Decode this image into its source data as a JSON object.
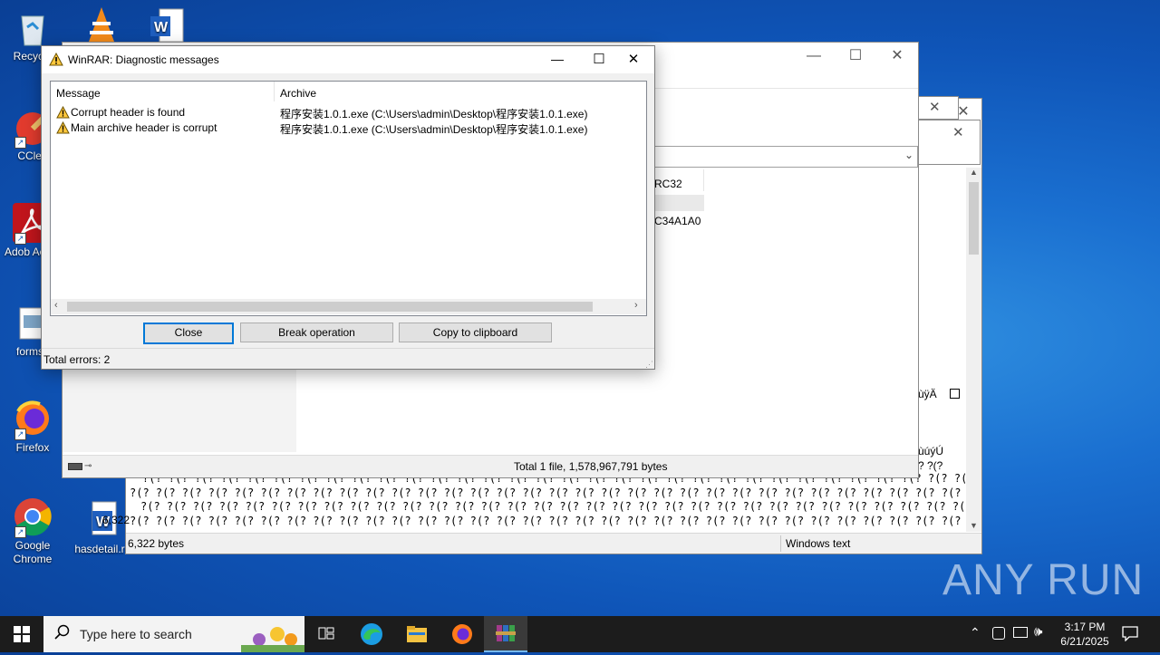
{
  "desktop": {
    "icons": [
      {
        "label": "Recycle"
      },
      {
        "label": "CClea"
      },
      {
        "label": "Adob Acrob"
      },
      {
        "label": "formsc"
      },
      {
        "label": "Firefox"
      },
      {
        "label": "Google Chrome"
      },
      {
        "label": "hasdetail.r"
      }
    ]
  },
  "notepad": {
    "garbage_line": "?(?  ?(?  ?(?  ?(?  ?(?  ?(?  ?(?  ?(?  ?(?  ?(?  ?(?  ?(?  ?(?  ?(?  ?(?  ?(?  ?(?  ?(?  ?(?  ?(?  ?(?  ?(?  ?(?  ?(?  ?(?  ?(?  ?(?  ?(?  ?(?  ?(?  ?(?  ?(?  ?(?",
    "side_text_1": "ùÿÄ",
    "side_text_2": "ùúýÚ",
    "side_text_3": "?  ?(?",
    "behind_text": "6,322",
    "status_size": "6,322 bytes",
    "status_encoding": "Windows text"
  },
  "winrar_main": {
    "col_crc": "RC32",
    "crc_value": "C34A1A0",
    "status_total": "Total 1 file, 1,578,967,791 bytes"
  },
  "dialog": {
    "title": "WinRAR: Diagnostic messages",
    "col_message": "Message",
    "col_archive": "Archive",
    "rows": [
      {
        "message": "Corrupt header is found",
        "archive": "程序安装1.0.1.exe (C:\\Users\\admin\\Desktop\\程序安装1.0.1.exe)"
      },
      {
        "message": "Main archive header is corrupt",
        "archive": "程序安装1.0.1.exe (C:\\Users\\admin\\Desktop\\程序安装1.0.1.exe)"
      }
    ],
    "btn_close": "Close",
    "btn_break": "Break operation",
    "btn_copy": "Copy to clipboard",
    "status": "Total errors: 2"
  },
  "taskbar": {
    "search_placeholder": "Type here to search",
    "time": "3:17 PM",
    "date": "6/21/2025"
  },
  "watermark": "ANY RUN"
}
